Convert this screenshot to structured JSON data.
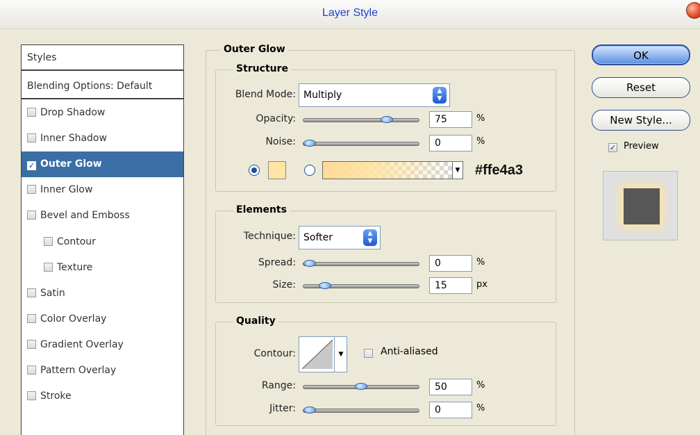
{
  "window": {
    "title": "Layer Style"
  },
  "sidebar": {
    "header": "Styles",
    "blending": "Blending Options: Default",
    "items": [
      {
        "label": "Drop Shadow",
        "checked": false
      },
      {
        "label": "Inner Shadow",
        "checked": false
      },
      {
        "label": "Outer Glow",
        "checked": true,
        "selected": true
      },
      {
        "label": "Inner Glow",
        "checked": false
      },
      {
        "label": "Bevel and Emboss",
        "checked": false
      },
      {
        "label": "Contour",
        "checked": false,
        "sub": true
      },
      {
        "label": "Texture",
        "checked": false,
        "sub": true
      },
      {
        "label": "Satin",
        "checked": false
      },
      {
        "label": "Color Overlay",
        "checked": false
      },
      {
        "label": "Gradient Overlay",
        "checked": false
      },
      {
        "label": "Pattern Overlay",
        "checked": false
      },
      {
        "label": "Stroke",
        "checked": false
      }
    ]
  },
  "outer_glow": {
    "title": "Outer Glow",
    "structure": {
      "title": "Structure",
      "blend_mode_label": "Blend Mode:",
      "blend_mode_value": "Multiply",
      "opacity_label": "Opacity:",
      "opacity_value": "75",
      "opacity_unit": "%",
      "opacity_fraction": 0.75,
      "noise_label": "Noise:",
      "noise_value": "0",
      "noise_unit": "%",
      "noise_fraction": 0.0,
      "color_hex": "#ffe4a3",
      "color_mode": "solid"
    },
    "elements": {
      "title": "Elements",
      "technique_label": "Technique:",
      "technique_value": "Softer",
      "spread_label": "Spread:",
      "spread_value": "0",
      "spread_unit": "%",
      "spread_fraction": 0.0,
      "size_label": "Size:",
      "size_value": "15",
      "size_unit": "px",
      "size_fraction": 0.15
    },
    "quality": {
      "title": "Quality",
      "contour_label": "Contour:",
      "anti_aliased_label": "Anti-aliased",
      "anti_aliased": false,
      "range_label": "Range:",
      "range_value": "50",
      "range_unit": "%",
      "range_fraction": 0.5,
      "jitter_label": "Jitter:",
      "jitter_value": "0",
      "jitter_unit": "%",
      "jitter_fraction": 0.0
    }
  },
  "buttons": {
    "ok": "OK",
    "reset": "Reset",
    "new_style": "New Style...",
    "preview_label": "Preview",
    "preview_checked": true
  },
  "colors": {
    "accent": "#3a6ea5",
    "glow": "#ffe4a3",
    "title": "#1e43c8"
  },
  "icons": {
    "close": "close-icon",
    "checkbox": "checkbox-icon",
    "dropdown": "dropdown-arrow-icon",
    "radio": "radio-icon"
  }
}
